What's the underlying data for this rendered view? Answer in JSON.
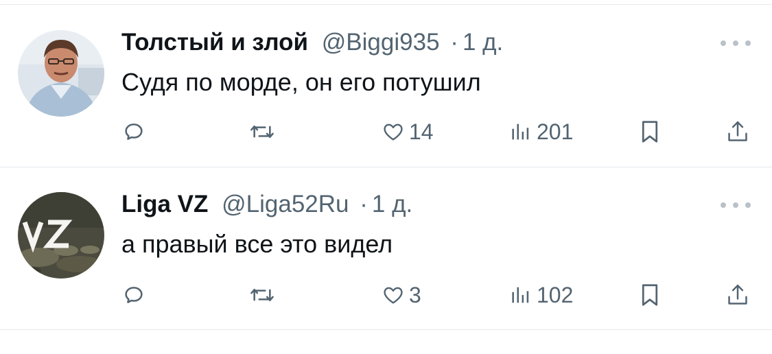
{
  "colors": {
    "text": "#0f1419",
    "muted": "#536471",
    "divider": "#e6e9ec",
    "icon": "#536471"
  },
  "tweets": [
    {
      "name": "Толстый и злой",
      "handle": "@Biggi935",
      "separator": "·",
      "time": "1 д.",
      "text": "Судя по морде, он его потушил",
      "likes": "14",
      "views": "201",
      "avatar_icon": "user-photo-man-in-shirt"
    },
    {
      "name": "Liga VZ",
      "handle": "@Liga52Ru",
      "separator": "·",
      "time": "1 д.",
      "text": "а правый все это видел",
      "likes": "3",
      "views": "102",
      "avatar_icon": "vz-logo-camouflage",
      "avatar_logo_text": "VZ"
    }
  ],
  "icons": {
    "reply": "reply-icon",
    "retweet": "retweet-icon",
    "like": "heart-icon",
    "views": "views-icon",
    "bookmark": "bookmark-icon",
    "share": "share-icon",
    "more": "more-icon"
  }
}
